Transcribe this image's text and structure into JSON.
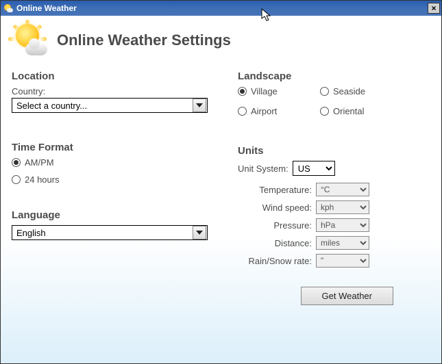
{
  "titlebar": {
    "title": "Online Weather",
    "close": "×"
  },
  "header": {
    "title": "Online Weather Settings"
  },
  "location": {
    "section": "Location",
    "country_label": "Country:",
    "country_value": "Select a country..."
  },
  "landscape": {
    "section": "Landscape",
    "options": {
      "village": "Village",
      "seaside": "Seaside",
      "airport": "Airport",
      "oriental": "Oriental"
    },
    "selected": "village"
  },
  "time_format": {
    "section": "Time Format",
    "ampm": "AM/PM",
    "h24": "24 hours",
    "selected": "ampm"
  },
  "language": {
    "section": "Language",
    "value": "English"
  },
  "units": {
    "section": "Units",
    "system_label": "Unit System:",
    "system_value": "US",
    "temperature_label": "Temperature:",
    "temperature_value": "°C",
    "wind_label": "Wind speed:",
    "wind_value": "kph",
    "pressure_label": "Pressure:",
    "pressure_value": "hPa",
    "distance_label": "Distance:",
    "distance_value": "miles",
    "rain_label": "Rain/Snow rate:",
    "rain_value": "\""
  },
  "footer": {
    "get_weather": "Get Weather"
  }
}
